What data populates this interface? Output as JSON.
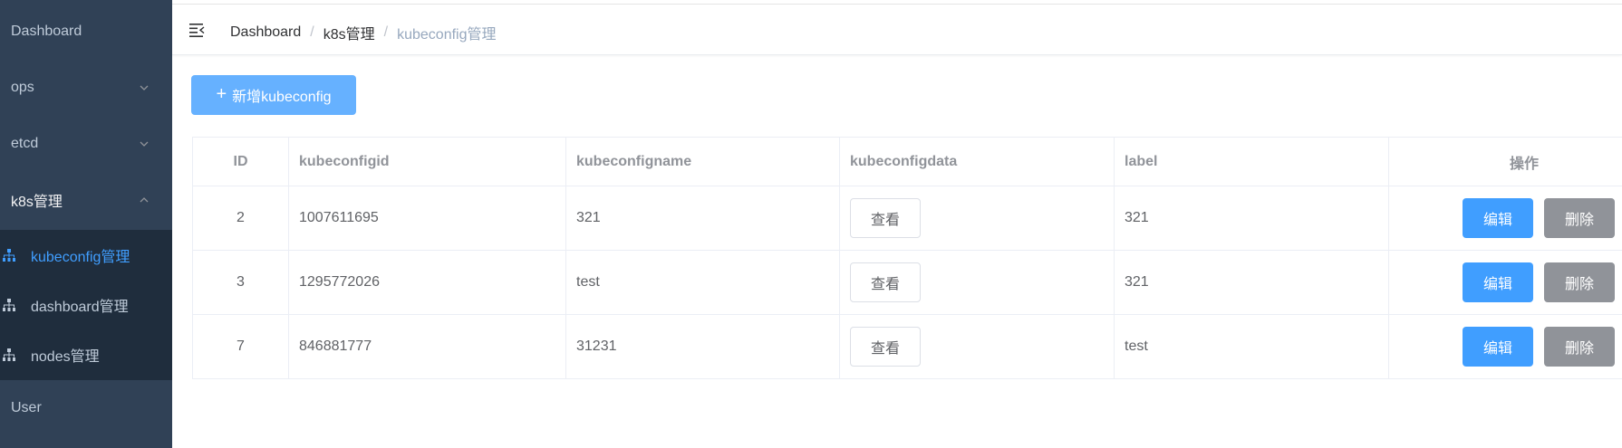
{
  "sidebar": {
    "items": [
      {
        "label": "Dashboard"
      },
      {
        "label": "ops"
      },
      {
        "label": "etcd"
      },
      {
        "label": "k8s管理"
      },
      {
        "label": "User"
      }
    ],
    "submenu": [
      {
        "label": "kubeconfig管理",
        "active": true
      },
      {
        "label": "dashboard管理"
      },
      {
        "label": "nodes管理"
      }
    ],
    "colors": {
      "bg": "#304156",
      "submenu_bg": "#1f2d3d",
      "active": "#409eff"
    }
  },
  "breadcrumb": {
    "items": [
      "Dashboard",
      "k8s管理",
      "kubeconfig管理"
    ],
    "separator": "/"
  },
  "toolbar": {
    "add_label": "新增kubeconfig",
    "add_icon": "+"
  },
  "table": {
    "headers": [
      "ID",
      "kubeconfigid",
      "kubeconfigname",
      "kubeconfigdata",
      "label",
      "操作"
    ],
    "rows": [
      {
        "id": "2",
        "kubeconfigid": "1007611695",
        "kubeconfigname": "321",
        "label": "321"
      },
      {
        "id": "3",
        "kubeconfigid": "1295772026",
        "kubeconfigname": "test",
        "label": "321"
      },
      {
        "id": "7",
        "kubeconfigid": "846881777",
        "kubeconfigname": "31231",
        "label": "test"
      }
    ],
    "view_label": "查看",
    "edit_label": "编辑",
    "delete_label": "删除"
  }
}
